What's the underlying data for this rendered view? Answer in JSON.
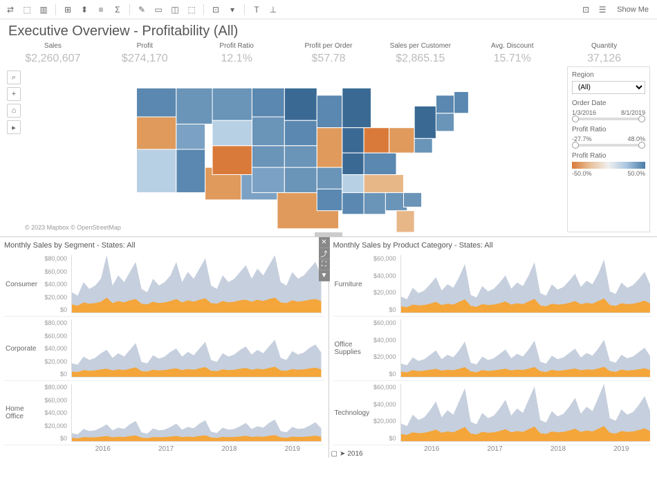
{
  "title": "Executive Overview - Profitability (All)",
  "show_me": "Show Me",
  "kpis": [
    {
      "label": "Sales",
      "value": "$2,260,607"
    },
    {
      "label": "Profit",
      "value": "$274,170"
    },
    {
      "label": "Profit Ratio",
      "value": "12.1%"
    },
    {
      "label": "Profit per Order",
      "value": "$57.78"
    },
    {
      "label": "Sales per Customer",
      "value": "$2,865.15"
    },
    {
      "label": "Avg. Discount",
      "value": "15.71%"
    },
    {
      "label": "Quantity",
      "value": "37,126"
    }
  ],
  "map_attr": "© 2023 Mapbox © OpenStreetMap",
  "filters": {
    "region_label": "Region",
    "region_value": "(All)",
    "orderdate_label": "Order Date",
    "orderdate_start": "1/3/2016",
    "orderdate_end": "8/1/2019",
    "profitratio_label": "Profit Ratio",
    "profitratio_min": "-27.7%",
    "profitratio_max": "48.0%",
    "legend_label": "Profit Ratio",
    "legend_min": "-50.0%",
    "legend_max": "50.0%"
  },
  "chart_left": {
    "title": "Monthly Sales by Segment - States: All",
    "rows": [
      "Consumer",
      "Corporate",
      "Home Office"
    ],
    "yticks": [
      "$80,000",
      "$60,000",
      "$40,000",
      "$20,000",
      "$0"
    ],
    "years": [
      "2016",
      "2017",
      "2018",
      "2019"
    ]
  },
  "chart_right": {
    "title": "Monthly Sales by Product Category - States: All",
    "rows": [
      "Furniture",
      "Office Supplies",
      "Technology"
    ],
    "yticks": [
      "$60,000",
      "$40,000",
      "$20,000",
      "$0"
    ],
    "years": [
      "2016",
      "2017",
      "2018",
      "2019"
    ],
    "toggle_year": "2016"
  },
  "chart_data": {
    "type": "area",
    "note": "Values estimated from pixel heights; monthly totals 2016-2019",
    "segment": {
      "Consumer": {
        "total": [
          30000,
          25000,
          45000,
          35000,
          40000,
          50000,
          85000,
          40000,
          55000,
          45000,
          60000,
          75000,
          35000,
          30000,
          50000,
          40000,
          45000,
          55000,
          75000,
          45000,
          60000,
          50000,
          65000,
          80000,
          40000,
          35000,
          55000,
          45000,
          50000,
          60000,
          70000,
          50000,
          65000,
          55000,
          70000,
          85000,
          45000,
          40000,
          60000,
          50000,
          55000,
          65000,
          75000,
          55000
        ],
        "profit": [
          12000,
          10000,
          15000,
          13000,
          14000,
          16000,
          22000,
          14000,
          17000,
          15000,
          18000,
          20000,
          13000,
          12000,
          16000,
          14000,
          15000,
          17000,
          20000,
          15000,
          18000,
          16000,
          19000,
          21000,
          14000,
          13000,
          17000,
          15000,
          16000,
          18000,
          19000,
          16000,
          19000,
          17000,
          20000,
          22000,
          15000,
          14000,
          18000,
          16000,
          17000,
          19000,
          20000,
          17000
        ]
      },
      "Corporate": {
        "total": [
          20000,
          18000,
          30000,
          25000,
          28000,
          35000,
          40000,
          28000,
          35000,
          30000,
          40000,
          50000,
          22000,
          20000,
          32000,
          27000,
          30000,
          37000,
          42000,
          30000,
          37000,
          32000,
          42000,
          52000,
          25000,
          22000,
          35000,
          30000,
          33000,
          40000,
          45000,
          33000,
          40000,
          35000,
          45000,
          55000,
          28000,
          25000,
          38000,
          33000,
          36000,
          43000,
          48000,
          36000
        ],
        "profit": [
          8000,
          7000,
          10000,
          9000,
          9500,
          11000,
          12000,
          9500,
          11000,
          10000,
          12000,
          14000,
          8500,
          8000,
          10500,
          9500,
          10000,
          11500,
          12500,
          10000,
          11500,
          10500,
          12500,
          14500,
          9000,
          8500,
          11000,
          10000,
          10500,
          12000,
          13000,
          10500,
          12000,
          11000,
          13000,
          15000,
          9500,
          9000,
          11500,
          10500,
          11000,
          12500,
          13500,
          11000
        ]
      },
      "Home Office": {
        "total": [
          12000,
          10000,
          18000,
          15000,
          16000,
          20000,
          25000,
          16000,
          20000,
          18000,
          25000,
          30000,
          13000,
          11000,
          19000,
          16000,
          17000,
          21000,
          26000,
          17000,
          21000,
          19000,
          26000,
          31000,
          14000,
          12000,
          20000,
          17000,
          18000,
          22000,
          27000,
          18000,
          22000,
          20000,
          27000,
          32000,
          15000,
          13000,
          21000,
          18000,
          19000,
          23000,
          28000,
          19000
        ],
        "profit": [
          5000,
          4000,
          6000,
          5500,
          5800,
          6500,
          7500,
          5800,
          6500,
          6000,
          7500,
          8500,
          5200,
          4500,
          6200,
          5700,
          6000,
          6700,
          7700,
          6000,
          6700,
          6200,
          7700,
          8700,
          5400,
          4700,
          6400,
          5900,
          6200,
          6900,
          7900,
          6200,
          6900,
          6400,
          7900,
          8900,
          5600,
          4900,
          6600,
          6100,
          6400,
          7100,
          8100,
          6400
        ]
      }
    },
    "category": {
      "Furniture": {
        "total": [
          18000,
          15000,
          28000,
          22000,
          25000,
          32000,
          40000,
          25000,
          32000,
          28000,
          40000,
          55000,
          20000,
          17000,
          30000,
          24000,
          27000,
          34000,
          42000,
          27000,
          34000,
          30000,
          42000,
          57000,
          22000,
          19000,
          32000,
          26000,
          29000,
          36000,
          44000,
          29000,
          36000,
          32000,
          44000,
          60000,
          24000,
          21000,
          34000,
          28000,
          31000,
          38000,
          46000,
          31000
        ],
        "profit": [
          7000,
          6000,
          9000,
          8000,
          8500,
          10000,
          12000,
          8500,
          10000,
          9000,
          12000,
          15000,
          7500,
          6500,
          9500,
          8500,
          9000,
          10500,
          12500,
          9000,
          10500,
          9500,
          12500,
          15500,
          8000,
          7000,
          10000,
          9000,
          9500,
          11000,
          13000,
          9500,
          11000,
          10000,
          13000,
          16000,
          8500,
          7500,
          10500,
          9500,
          10000,
          11500,
          13500,
          10000
        ]
      },
      "Office Supplies": {
        "total": [
          15000,
          13000,
          22000,
          18000,
          20000,
          25000,
          30000,
          20000,
          25000,
          22000,
          30000,
          40000,
          16000,
          14000,
          23000,
          19000,
          21000,
          26000,
          31000,
          21000,
          26000,
          23000,
          31000,
          41000,
          17000,
          15000,
          24000,
          20000,
          22000,
          27000,
          32000,
          22000,
          27000,
          24000,
          32000,
          42000,
          18000,
          16000,
          25000,
          21000,
          23000,
          28000,
          33000,
          23000
        ],
        "profit": [
          6000,
          5000,
          7500,
          6500,
          7000,
          8000,
          9000,
          7000,
          8000,
          7500,
          9000,
          11000,
          6200,
          5200,
          7700,
          6700,
          7200,
          8200,
          9200,
          7200,
          8200,
          7700,
          9200,
          11200,
          6400,
          5400,
          7900,
          6900,
          7400,
          8400,
          9400,
          7400,
          8400,
          7900,
          9400,
          11400,
          6600,
          5600,
          8100,
          7100,
          7600,
          8600,
          9600,
          7600
        ]
      },
      "Technology": {
        "total": [
          20000,
          17000,
          30000,
          24000,
          27000,
          35000,
          45000,
          27000,
          35000,
          30000,
          45000,
          60000,
          22000,
          19000,
          32000,
          26000,
          29000,
          37000,
          47000,
          29000,
          37000,
          32000,
          47000,
          62000,
          24000,
          21000,
          34000,
          28000,
          31000,
          39000,
          49000,
          31000,
          39000,
          34000,
          49000,
          65000,
          26000,
          23000,
          36000,
          30000,
          33000,
          41000,
          51000,
          33000
        ],
        "profit": [
          8000,
          7000,
          10000,
          9000,
          9500,
          11000,
          13000,
          9500,
          11000,
          10000,
          13000,
          16000,
          8500,
          7500,
          10500,
          9500,
          10000,
          11500,
          13500,
          10000,
          11500,
          10500,
          13500,
          16500,
          9000,
          8000,
          11000,
          10000,
          10500,
          12000,
          14000,
          10500,
          12000,
          11000,
          14000,
          17000,
          9500,
          8500,
          11500,
          10500,
          11000,
          12500,
          14500,
          11000
        ]
      }
    }
  }
}
